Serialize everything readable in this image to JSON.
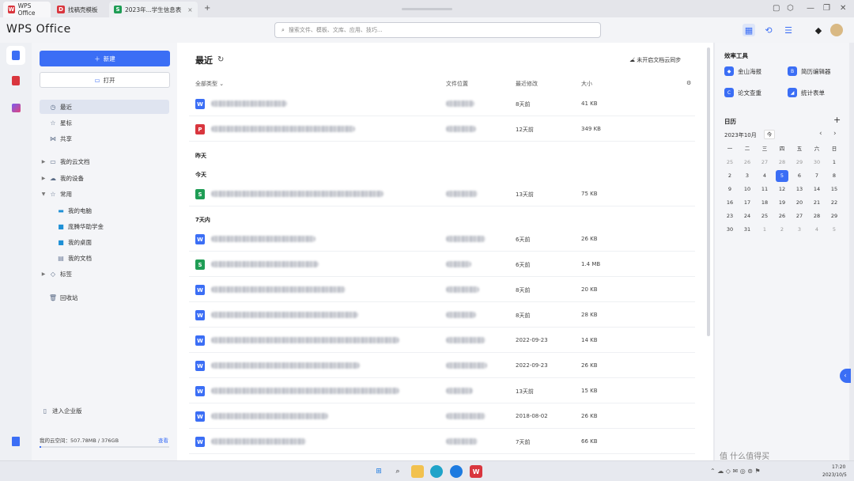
{
  "tabs": [
    {
      "label": "WPS Office"
    },
    {
      "label": "找稿壳模板"
    },
    {
      "label": "2023年...学生信息表"
    }
  ],
  "app_logo": "WPS Office",
  "search": {
    "placeholder": "搜索文件、模板、文库、应用、技巧..."
  },
  "sidebar": {
    "new_label": "新建",
    "open_label": "打开",
    "items": [
      {
        "label": "最近"
      },
      {
        "label": "星标"
      },
      {
        "label": "共享"
      },
      {
        "label": "我的云文档"
      },
      {
        "label": "我的设备"
      },
      {
        "label": "常用"
      },
      {
        "label": "我的电脑"
      },
      {
        "label": "庞腾华助学金"
      },
      {
        "label": "我的桌面"
      },
      {
        "label": "我的文档"
      },
      {
        "label": "标签"
      },
      {
        "label": "回收站"
      }
    ],
    "enterprise_label": "进入企业版",
    "storage_label": "我的云空间：507.78MB / 376GB",
    "storage_link": "查看"
  },
  "main": {
    "title": "最近",
    "sync_label": "未开启文档云同步",
    "columns": {
      "type": "全部类型",
      "location": "文件位置",
      "modified": "最近修改",
      "size": "大小"
    },
    "sections": {
      "yesterday": "昨天",
      "today": "今天",
      "week": "7天内"
    },
    "files": [
      {
        "kind": "W",
        "modified": "8天前",
        "size": "41 KB"
      },
      {
        "kind": "P",
        "modified": "12天前",
        "size": "349 KB"
      },
      {
        "kind": "S",
        "modified": "13天前",
        "size": "75 KB"
      },
      {
        "kind": "W",
        "modified": "6天前",
        "size": "26 KB"
      },
      {
        "kind": "S",
        "modified": "6天前",
        "size": "1.4 MB"
      },
      {
        "kind": "W",
        "modified": "8天前",
        "size": "20 KB"
      },
      {
        "kind": "W",
        "modified": "8天前",
        "size": "28 KB"
      },
      {
        "kind": "W",
        "modified": "2022-09-23",
        "size": "14 KB"
      },
      {
        "kind": "W",
        "modified": "2022-09-23",
        "size": "26 KB"
      },
      {
        "kind": "W",
        "modified": "13天前",
        "size": "15 KB"
      },
      {
        "kind": "W",
        "modified": "2018-08-02",
        "size": "26 KB"
      },
      {
        "kind": "W",
        "modified": "7天前",
        "size": "66 KB"
      }
    ]
  },
  "right": {
    "tools_title": "效率工具",
    "tools": [
      {
        "label": "金山海报"
      },
      {
        "label": "简历编辑器"
      },
      {
        "label": "论文查重"
      },
      {
        "label": "统计表单"
      }
    ],
    "calendar_title": "日历",
    "month": "2023年10月",
    "today_btn": "今",
    "weekdays": [
      "一",
      "二",
      "三",
      "四",
      "五",
      "六",
      "日"
    ],
    "weeks": [
      [
        "25",
        "26",
        "27",
        "28",
        "29",
        "30",
        "1"
      ],
      [
        "2",
        "3",
        "4",
        "5",
        "6",
        "7",
        "8"
      ],
      [
        "9",
        "10",
        "11",
        "12",
        "13",
        "14",
        "15"
      ],
      [
        "16",
        "17",
        "18",
        "19",
        "20",
        "21",
        "22"
      ],
      [
        "23",
        "24",
        "25",
        "26",
        "27",
        "28",
        "29"
      ],
      [
        "30",
        "31",
        "1",
        "2",
        "3",
        "4",
        "5"
      ]
    ]
  },
  "taskbar": {
    "date": "2023/10/5",
    "time": "17:20"
  },
  "watermark": "值 什么值得买",
  "colors": {
    "accent": "#3b6ef5",
    "word": "#3b6ef5",
    "sheet": "#1f9d55",
    "ppt": "#d9363e"
  }
}
